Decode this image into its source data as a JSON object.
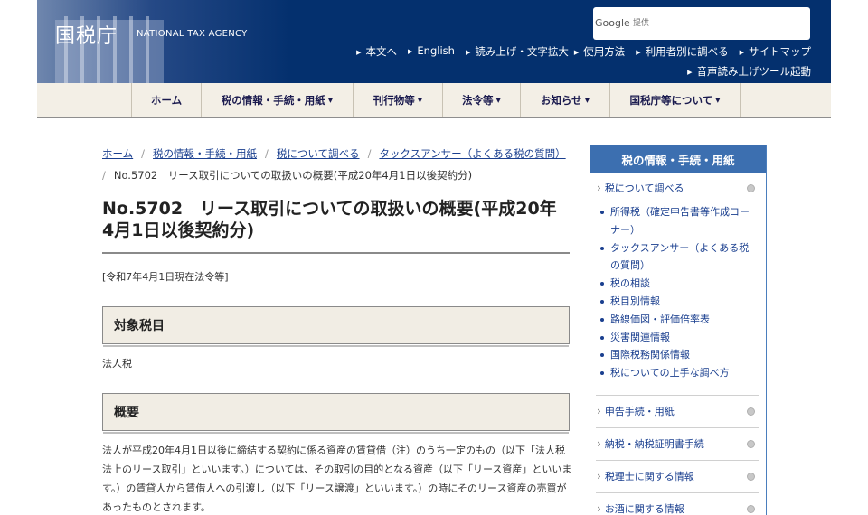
{
  "header": {
    "site_name": "国税庁",
    "site_sub": "NATIONAL TAX AGENCY",
    "search_logo": "Google",
    "search_placeholder": "提供",
    "util_links": [
      "本文へ",
      "English",
      "読み上げ・文字拡大",
      "使用方法",
      "利用者別に調べる",
      "サイトマップ"
    ],
    "util_link_2": "音声読み上げツール起動"
  },
  "gnav": {
    "items": [
      {
        "label": "ホーム",
        "dropdown": false
      },
      {
        "label": "税の情報・手続・用紙",
        "dropdown": true
      },
      {
        "label": "刊行物等",
        "dropdown": true
      },
      {
        "label": "法令等",
        "dropdown": true
      },
      {
        "label": "お知らせ",
        "dropdown": true
      },
      {
        "label": "国税庁等について",
        "dropdown": true
      }
    ]
  },
  "breadcrumb": {
    "items": [
      "ホーム",
      "税の情報・手続・用紙",
      "税について調べる",
      "タックスアンサー（よくある税の質問）"
    ],
    "current": "No.5702　リース取引についての取扱いの概要(平成20年4月1日以後契約分)"
  },
  "page": {
    "title": "No.5702　リース取引についての取扱いの概要(平成20年4月1日以後契約分)",
    "date_note": "[令和7年4月1日現在法令等]",
    "section1_heading": "対象税目",
    "section1_text": "法人税",
    "section2_heading": "概要",
    "section2_text": "法人が平成20年4月1日以後に締結する契約に係る資産の賃貸借（注）のうち一定のもの（以下「法人税法上のリース取引」といいます。）については、その取引の目的となる資産（以下「リース資産」といいます。）の賃貸人から賃借人への引渡し（以下「リース譲渡」といいます。）の時にそのリース資産の売買があったものとされます。"
  },
  "sidebar": {
    "heading": "税の情報・手続・用紙",
    "category_main": "税について調べる",
    "sub_items": [
      "所得税（確定申告書等作成コーナー）",
      "タックスアンサー（よくある税の質問）",
      "税の相談",
      "税目別情報",
      "路線価図・評価倍率表",
      "災害関連情報",
      "国際税務関係情報",
      "税についての上手な調べ方"
    ],
    "categories": [
      "申告手続・用紙",
      "納税・納税証明書手続",
      "税理士に関する情報",
      "お酒に関する情報"
    ]
  }
}
